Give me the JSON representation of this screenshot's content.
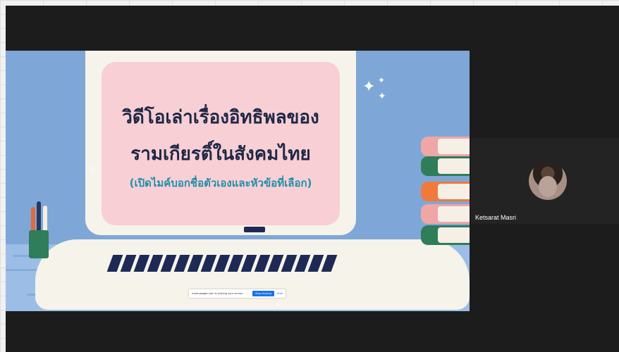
{
  "slide": {
    "title_line1": "วิดีโอเล่าเรื่องอิทธิพลของ",
    "title_line2": "รามเกียรติ์ในสังคมไทย",
    "subtitle": "(เปิดไมค์บอกชื่อตัวเองและหัวข้อที่เลือก)"
  },
  "share_banner": {
    "message": "meet.google.com is sharing your screen.",
    "stop_label": "Stop sharing",
    "hide_label": "Hide"
  },
  "participant": {
    "name": "Ketsarat Masri"
  },
  "colors": {
    "slide_bg": "#7ea7d8",
    "screen_panel": "#f7cfd4",
    "title_text": "#1f2846",
    "subtitle_text": "#1f8fa8",
    "stage_bg": "#1c1c1c"
  },
  "icons": [
    "sparkle-icon",
    "pen-cup-icon",
    "book-stack-icon",
    "cursor-icon"
  ]
}
